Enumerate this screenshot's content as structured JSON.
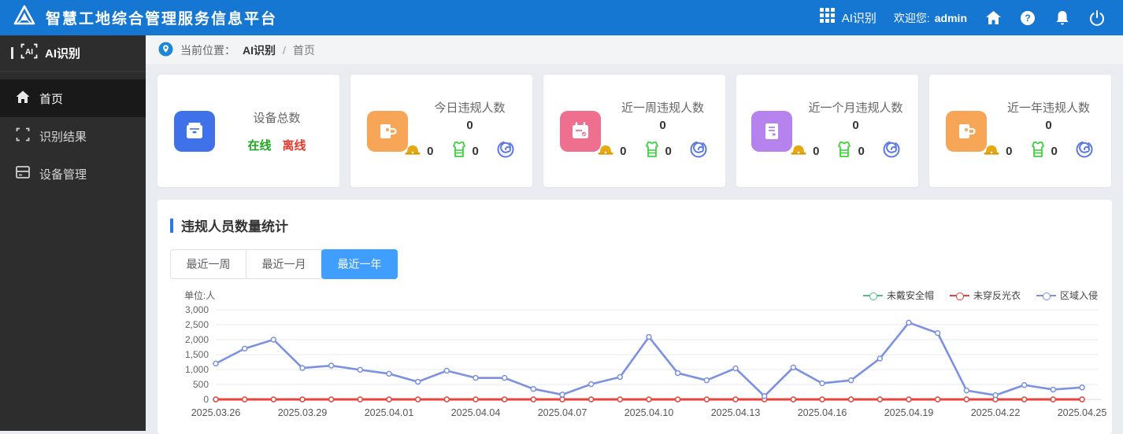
{
  "header": {
    "title": "智慧工地综合管理服务信息平台",
    "app_switcher_label": "AI识别",
    "welcome_label": "欢迎您:",
    "username": "admin"
  },
  "sidebar": {
    "title": "AI识别",
    "items": [
      {
        "label": "首页",
        "active": true
      },
      {
        "label": "识别结果",
        "active": false
      },
      {
        "label": "设备管理",
        "active": false
      }
    ]
  },
  "breadcrumb": {
    "prefix": "当前位置：",
    "root": "AI识别",
    "separator": "/",
    "current": "首页"
  },
  "cards": [
    {
      "title": "设备总数",
      "icon_color": "#3f72e8",
      "online_label": "在线",
      "offline_label": "离线"
    },
    {
      "title": "今日违规人数",
      "total": "0",
      "icon_color": "#f7a658",
      "helmet_count": "0",
      "vest_count": "0"
    },
    {
      "title": "近一周违规人数",
      "total": "0",
      "icon_color": "#ee6f8e",
      "helmet_count": "0",
      "vest_count": "0"
    },
    {
      "title": "近一个月违规人数",
      "total": "0",
      "icon_color": "#b683ee",
      "helmet_count": "0",
      "vest_count": "0"
    },
    {
      "title": "近一年违规人数",
      "total": "0",
      "icon_color": "#f7a658",
      "helmet_count": "0",
      "vest_count": "0"
    }
  ],
  "panel": {
    "title": "违规人员数量统计"
  },
  "tabs": [
    {
      "label": "最近一周",
      "active": false
    },
    {
      "label": "最近一月",
      "active": false
    },
    {
      "label": "最近一年",
      "active": true
    }
  ],
  "colors": {
    "accent": "#409eff",
    "online": "#1fa81f",
    "offline": "#e6392f",
    "helmet": "#e8a812",
    "vest": "#3ed13e",
    "intrusion": "#5b79e3"
  },
  "chart_data": {
    "type": "line",
    "title": "违规人员数量统计",
    "unit_label": "单位:人",
    "grid": true,
    "legend_position": "top-right",
    "ylim": [
      0,
      3000
    ],
    "y_ticks": [
      0,
      500,
      1000,
      1500,
      2000,
      2500,
      3000
    ],
    "y_tick_labels": [
      "0",
      "500",
      "1,000",
      "1,500",
      "2,000",
      "2,500",
      "3,000"
    ],
    "x_tick_every": 3,
    "x": [
      "2025.03.26",
      "2025.03.27",
      "2025.03.28",
      "2025.03.29",
      "2025.03.30",
      "2025.03.31",
      "2025.04.01",
      "2025.04.02",
      "2025.04.03",
      "2025.04.04",
      "2025.04.05",
      "2025.04.06",
      "2025.04.07",
      "2025.04.08",
      "2025.04.09",
      "2025.04.10",
      "2025.04.11",
      "2025.04.12",
      "2025.04.13",
      "2025.04.14",
      "2025.04.15",
      "2025.04.16",
      "2025.04.17",
      "2025.04.18",
      "2025.04.19",
      "2025.04.20",
      "2025.04.21",
      "2025.04.22",
      "2025.04.23",
      "2025.04.24",
      "2025.04.25"
    ],
    "series": [
      {
        "name": "未戴安全帽",
        "color": "#57bd8a",
        "line_width": 2,
        "values": [
          0,
          0,
          0,
          0,
          0,
          0,
          0,
          0,
          0,
          0,
          0,
          0,
          0,
          0,
          0,
          0,
          0,
          0,
          0,
          0,
          0,
          0,
          0,
          0,
          0,
          0,
          0,
          0,
          0,
          0,
          0
        ]
      },
      {
        "name": "未穿反光衣",
        "color": "#e8433e",
        "line_width": 3,
        "values": [
          0,
          0,
          0,
          0,
          0,
          0,
          0,
          0,
          0,
          0,
          0,
          0,
          0,
          0,
          0,
          0,
          0,
          0,
          0,
          0,
          0,
          0,
          0,
          0,
          0,
          0,
          0,
          0,
          0,
          0,
          0
        ]
      },
      {
        "name": "区域入侵",
        "color": "#7c91e2",
        "line_width": 2.6,
        "values": [
          1200,
          1700,
          2000,
          1050,
          1130,
          990,
          860,
          590,
          960,
          720,
          720,
          350,
          160,
          510,
          750,
          2090,
          880,
          640,
          1040,
          110,
          1070,
          540,
          640,
          1370,
          2570,
          2220,
          300,
          140,
          480,
          330,
          400
        ]
      }
    ]
  }
}
